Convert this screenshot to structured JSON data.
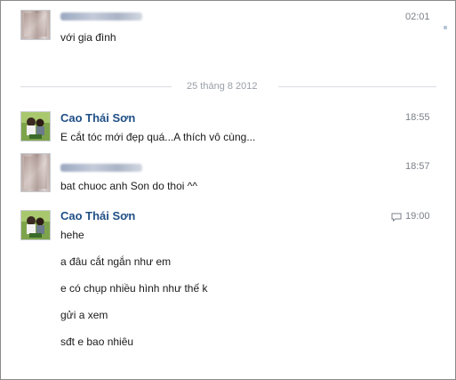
{
  "messages": [
    {
      "sender": "",
      "time": "02:01",
      "lines": [
        "với gia đình"
      ]
    },
    {
      "date_divider": "25 tháng 8 2012"
    },
    {
      "sender": "Cao Thái Sơn",
      "time": "18:55",
      "lines": [
        "E cắt tóc mới đẹp quá...A thích vô cùng..."
      ]
    },
    {
      "sender": "",
      "time": "18:57",
      "lines": [
        "bat chuoc anh Son do thoi ^^"
      ]
    },
    {
      "sender": "Cao Thái Sơn",
      "time": "19:00",
      "lines": [
        "hehe",
        "a đâu cắt ngắn như em",
        "e có chụp nhiều hình như thế k",
        "gửi a xem",
        "sđt e bao nhiêu"
      ]
    }
  ],
  "icons": {
    "comment": "comment-icon",
    "blurred_avatar": "avatar-icon",
    "photo_avatar": "avatar-icon"
  },
  "colors": {
    "sender": "#1f4f86",
    "time": "#7b8088",
    "divider": "#d9dde3"
  }
}
